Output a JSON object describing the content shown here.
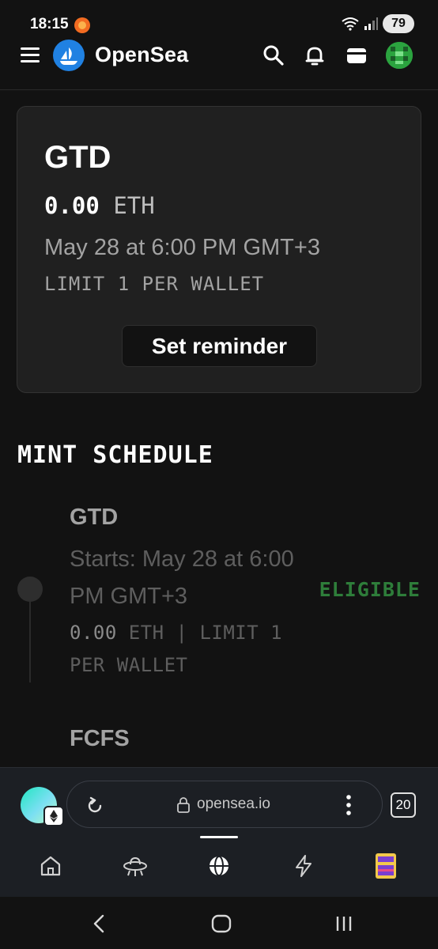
{
  "status_bar": {
    "time": "18:15",
    "battery": "79"
  },
  "header": {
    "brand": "OpenSea",
    "icons": [
      "menu-icon",
      "opensea-logo-icon",
      "search-icon",
      "bell-icon",
      "wallet-icon",
      "avatar"
    ]
  },
  "card": {
    "title": "GTD",
    "price_value": "0.00",
    "price_unit": "ETH",
    "date": "May 28 at 6:00 PM GMT+3",
    "limit": "LIMIT 1 PER WALLET",
    "reminder_label": "Set reminder"
  },
  "schedule": {
    "heading": "MINT SCHEDULE",
    "stages": [
      {
        "name": "GTD",
        "starts": "Starts: May 28 at 6:00 PM GMT+3",
        "status": "ELIGIBLE",
        "price_value": "0.00",
        "details": "ETH | LIMIT 1 PER WALLET"
      },
      {
        "name": "FCFS"
      }
    ]
  },
  "browser": {
    "url": "opensea.io",
    "tab_count": "20",
    "nav_items": [
      "home-icon",
      "ufo-icon",
      "globe-icon",
      "lightning-icon",
      "game-icon"
    ]
  },
  "colors": {
    "background": "#121212",
    "card": "#202020",
    "eligible": "#2e7d3a",
    "brand_blue": "#2081e2"
  }
}
